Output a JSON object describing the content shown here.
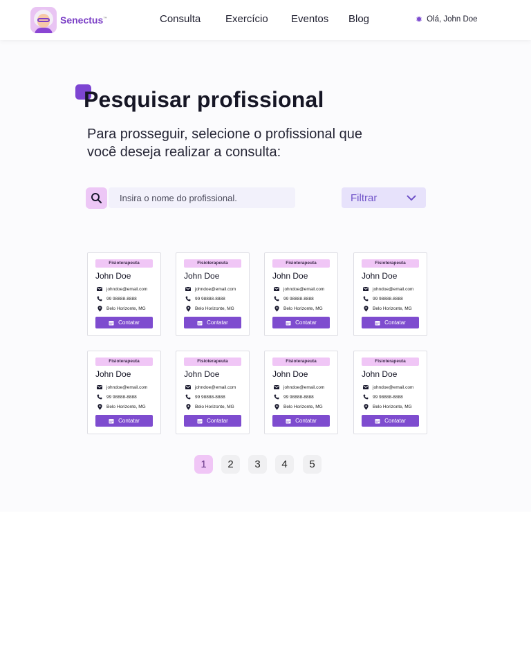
{
  "header": {
    "brand": "Senectus",
    "brand_mark": "™",
    "nav": [
      {
        "label": "Consulta"
      },
      {
        "label": "Exercício"
      },
      {
        "label": "Eventos"
      },
      {
        "label": "Blog"
      }
    ],
    "greeting": "Olá, John Doe",
    "greeting_icon": "gear-icon"
  },
  "main": {
    "title": "Pesquisar profissional",
    "subtitle": "Para prosseguir, selecione o profissional que você deseja realizar a consulta:",
    "search": {
      "placeholder": "Insira o nome do profissional.",
      "value": "",
      "icon": "search-icon"
    },
    "filter": {
      "label": "Filtrar",
      "icon": "chevron-down-icon"
    }
  },
  "professionals": [
    {
      "specialty": "Fisioterapeuta",
      "name": "John Doe",
      "email": "johndoe@email.com",
      "phone": "99 98888-8888",
      "location": "Belo Horizonte, MG",
      "action": "Contatar"
    },
    {
      "specialty": "Fisioterapeuta",
      "name": "John Doe",
      "email": "johndoe@email.com",
      "phone": "99 98888-8888",
      "location": "Belo Horizonte, MG",
      "action": "Contatar"
    },
    {
      "specialty": "Fisioterapeuta",
      "name": "John Doe",
      "email": "johndoe@email.com",
      "phone": "99 98888-8888",
      "location": "Belo Horizonte, MG",
      "action": "Contatar"
    },
    {
      "specialty": "Fisioterapeuta",
      "name": "John Doe",
      "email": "johndoe@email.com",
      "phone": "99 98888-8888",
      "location": "Belo Horizonte, MG",
      "action": "Contatar"
    },
    {
      "specialty": "Fisioterapeuta",
      "name": "John Doe",
      "email": "johndoe@email.com",
      "phone": "99 98888-8888",
      "location": "Belo Horizonte, MG",
      "action": "Contatar"
    },
    {
      "specialty": "Fisioterapeuta",
      "name": "John Doe",
      "email": "johndoe@email.com",
      "phone": "99 98888-8888",
      "location": "Belo Horizonte, MG",
      "action": "Contatar"
    },
    {
      "specialty": "Fisioterapeuta",
      "name": "John Doe",
      "email": "johndoe@email.com",
      "phone": "99 98888-8888",
      "location": "Belo Horizonte, MG",
      "action": "Contatar"
    },
    {
      "specialty": "Fisioterapeuta",
      "name": "John Doe",
      "email": "johndoe@email.com",
      "phone": "99 98888-8888",
      "location": "Belo Horizonte, MG",
      "action": "Contatar"
    }
  ],
  "pagination": {
    "pages": [
      "1",
      "2",
      "3",
      "4",
      "5"
    ],
    "current": "1"
  },
  "colors": {
    "accent": "#7e4ccf",
    "badge": "#f0c6f6",
    "filter_bg": "#e7e2fb",
    "search_bg": "#f2f1fb"
  }
}
